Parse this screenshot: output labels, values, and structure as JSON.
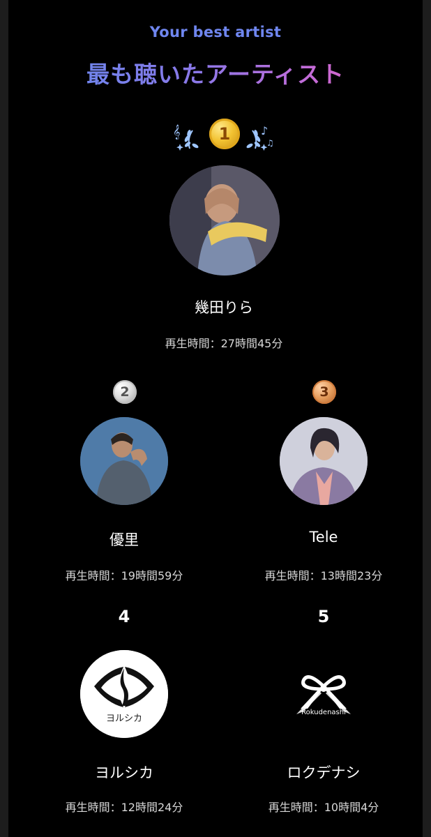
{
  "header": {
    "subtitle": "Your best artist",
    "title": "最も聴いたアーティスト"
  },
  "artists": [
    {
      "rank": "1",
      "name": "幾田りら",
      "playtime": "再生時間：27時間45分",
      "badge": "gold-medal"
    },
    {
      "rank": "2",
      "name": "優里",
      "playtime": "再生時間：19時間59分",
      "badge": "silver-medal"
    },
    {
      "rank": "3",
      "name": "Tele",
      "playtime": "再生時間：13時間23分",
      "badge": "bronze-medal"
    },
    {
      "rank": "4",
      "name": "ヨルシカ",
      "playtime": "再生時間：12時間24分",
      "badge": "plain-number"
    },
    {
      "rank": "5",
      "name": "ロクデナシ",
      "playtime": "再生時間：10時間4分",
      "badge": "plain-number"
    }
  ],
  "logos": {
    "yorushika_text": "ヨルシカ",
    "rokudenashi_text": "Rokudenashi"
  },
  "colors": {
    "background": "#000000",
    "subtitle": "#6f86ef",
    "title_gradient": [
      "#5f8df0",
      "#8a78e8",
      "#c76ad6",
      "#e85aa8"
    ],
    "gold": "#f2c231",
    "silver": "#d9d9d9",
    "bronze": "#e39a5a"
  }
}
